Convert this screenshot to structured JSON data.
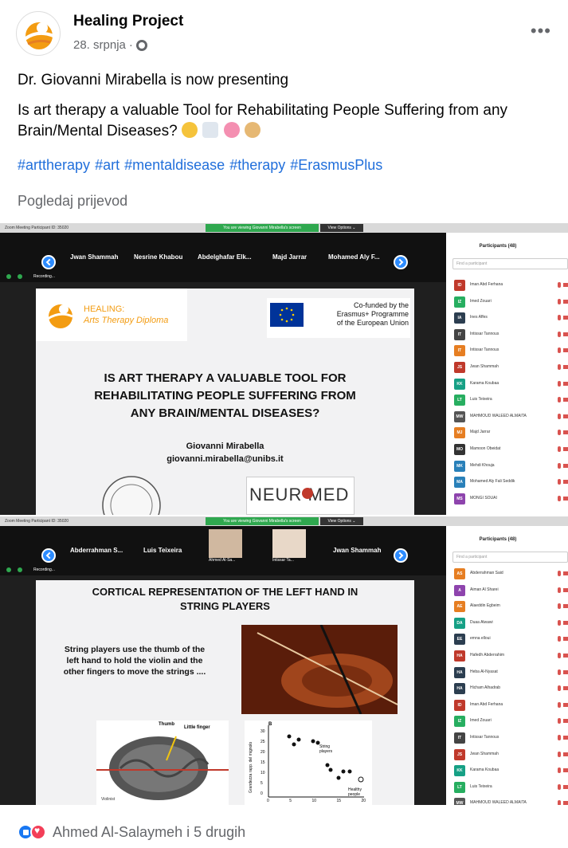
{
  "post": {
    "page_name": "Healing Project",
    "date": "28. srpnja",
    "more": "•••",
    "line1": "Dr. Giovanni Mirabella is now presenting",
    "line2": "Is art therapy a valuable Tool for Rehabilitating People Suffering from any Brain/Mental Diseases?",
    "emoji_names": [
      "thinking-face-icon",
      "doctor-icon",
      "brain-icon",
      "palette-icon"
    ],
    "hashtags": [
      "#arttherapy",
      "#art",
      "#mentaldisease",
      "#therapy",
      "#ErasmusPlus"
    ],
    "translate": "Pogledaj prijevod",
    "reactions_text": "Ahmed Al-Salaymeh i 5 drugih"
  },
  "zoom1": {
    "window_title": "Zoom Meeting Participant ID: 35020",
    "viewing": "You are viewing Giovanni Mirabella's screen",
    "view_options": "View Options ⌄",
    "thumbs": [
      "Jwan Shammah",
      "Nesrine Khabou",
      "Abdelghafar Elk...",
      "Majd Jarrar",
      "Mohamed Aly F..."
    ],
    "recording": "Recording...",
    "slide": {
      "logo_line1": "HEALING:",
      "logo_line2": "Arts Therapy Diploma",
      "eu_line1": "Co-funded by the",
      "eu_line2": "Erasmus+ Programme",
      "eu_line3": "of the European Union",
      "title_line1": "IS ART THERAPY A VALUABLE TOOL FOR",
      "title_line2": "REHABILITATING PEOPLE SUFFERING FROM",
      "title_line3": "ANY BRAIN/MENTAL DISEASES?",
      "author": "Giovanni Mirabella",
      "email": "giovanni.mirabella@unibs.it",
      "neuromed": "NEUR  MED"
    },
    "participants_title": "Participants (48)",
    "search_placeholder": "Find a participant",
    "participants": [
      {
        "initials": "ID",
        "name": "Iman Abd Ferhana",
        "color": "#c0392b"
      },
      {
        "initials": "IZ",
        "name": "Imed Zouari",
        "color": "#27ae60"
      },
      {
        "initials": "IA",
        "name": "Ines Affes",
        "color": "#2c3e50"
      },
      {
        "initials": "IT",
        "name": "Intissar Tannous",
        "color": "#444"
      },
      {
        "initials": "IT",
        "name": "Intissar Tannous",
        "color": "#e67e22"
      },
      {
        "initials": "JS",
        "name": "Jwan Shammah",
        "color": "#c0392b"
      },
      {
        "initials": "KK",
        "name": "Karama Koubaa",
        "color": "#16a085"
      },
      {
        "initials": "LT",
        "name": "Luis Teixeira",
        "color": "#27ae60"
      },
      {
        "initials": "MW",
        "name": "MAHMOUD WALEED ALMAITA",
        "color": "#555"
      },
      {
        "initials": "MJ",
        "name": "Majd Jarrar",
        "color": "#e67e22"
      },
      {
        "initials": "MO",
        "name": "Mamoon Obeidat",
        "color": "#333"
      },
      {
        "initials": "MK",
        "name": "Mehdi Khouja",
        "color": "#2980b9"
      },
      {
        "initials": "MA",
        "name": "Mohamed Aly Fali Seddik",
        "color": "#2980b9"
      },
      {
        "initials": "MS",
        "name": "MONGI SOUAI",
        "color": "#8e44ad"
      }
    ]
  },
  "zoom2": {
    "window_title": "Zoom Meeting Participant ID: 35020",
    "viewing": "You are viewing Giovanni Mirabella's screen",
    "view_options": "View Options ⌄",
    "thumbs": [
      "Abderrahman S...",
      "Luis Teixeira",
      "Ahmed Al-Sa...",
      "Intissar Ta...",
      "Jwan Shammah"
    ],
    "recording": "Recording...",
    "slide": {
      "title_line1": "CORTICAL REPRESENTATION OF THE LEFT HAND IN",
      "title_line2": "STRING PLAYERS",
      "body_line1": "String players use the thumb of the",
      "body_line2": "left hand to hold the violin and the",
      "body_line3": "other fingers to move the strings ....",
      "thumb_label": "Thumb",
      "little_label": "Little finger",
      "violinist": "Violinist",
      "panel_label": "B",
      "string_players": "String players",
      "healthy": "Healthy people",
      "ylabel": "Grandezza rapp. del mignolo",
      "y_ticks": [
        "30",
        "25",
        "20",
        "15",
        "10",
        "5",
        "0"
      ],
      "x_ticks": [
        "0",
        "5",
        "10",
        "15",
        "20"
      ]
    },
    "participants_title": "Participants (48)",
    "search_placeholder": "Find a participant",
    "participants": [
      {
        "initials": "AS",
        "name": "Abderrahman Said",
        "color": "#e67e22"
      },
      {
        "initials": "A",
        "name": "Aiman Al Sharei",
        "color": "#8e44ad"
      },
      {
        "initials": "AE",
        "name": "Alaeddin Egbeim",
        "color": "#e67e22"
      },
      {
        "initials": "DA",
        "name": "Duaa Alwawi",
        "color": "#16a085"
      },
      {
        "initials": "EE",
        "name": "emna elloui",
        "color": "#2c3e50"
      },
      {
        "initials": "HA",
        "name": "Hafedh Abderrahim",
        "color": "#c0392b"
      },
      {
        "initials": "HA",
        "name": "Heba Al-Nyasat",
        "color": "#2c3e50"
      },
      {
        "initials": "HA",
        "name": "Hicham Alhadrab",
        "color": "#2c3e50"
      },
      {
        "initials": "ID",
        "name": "Iman Abd Ferhana",
        "color": "#c0392b"
      },
      {
        "initials": "IZ",
        "name": "Imed Zouari",
        "color": "#27ae60"
      },
      {
        "initials": "IT",
        "name": "Intissar Tannous",
        "color": "#444"
      },
      {
        "initials": "JS",
        "name": "Jwan Shammah",
        "color": "#c0392b"
      },
      {
        "initials": "KK",
        "name": "Karama Koubaa",
        "color": "#16a085"
      },
      {
        "initials": "LT",
        "name": "Luis Teixeira",
        "color": "#27ae60"
      },
      {
        "initials": "MW",
        "name": "MAHMOUD WALEED ALMAITA",
        "color": "#555"
      }
    ]
  }
}
